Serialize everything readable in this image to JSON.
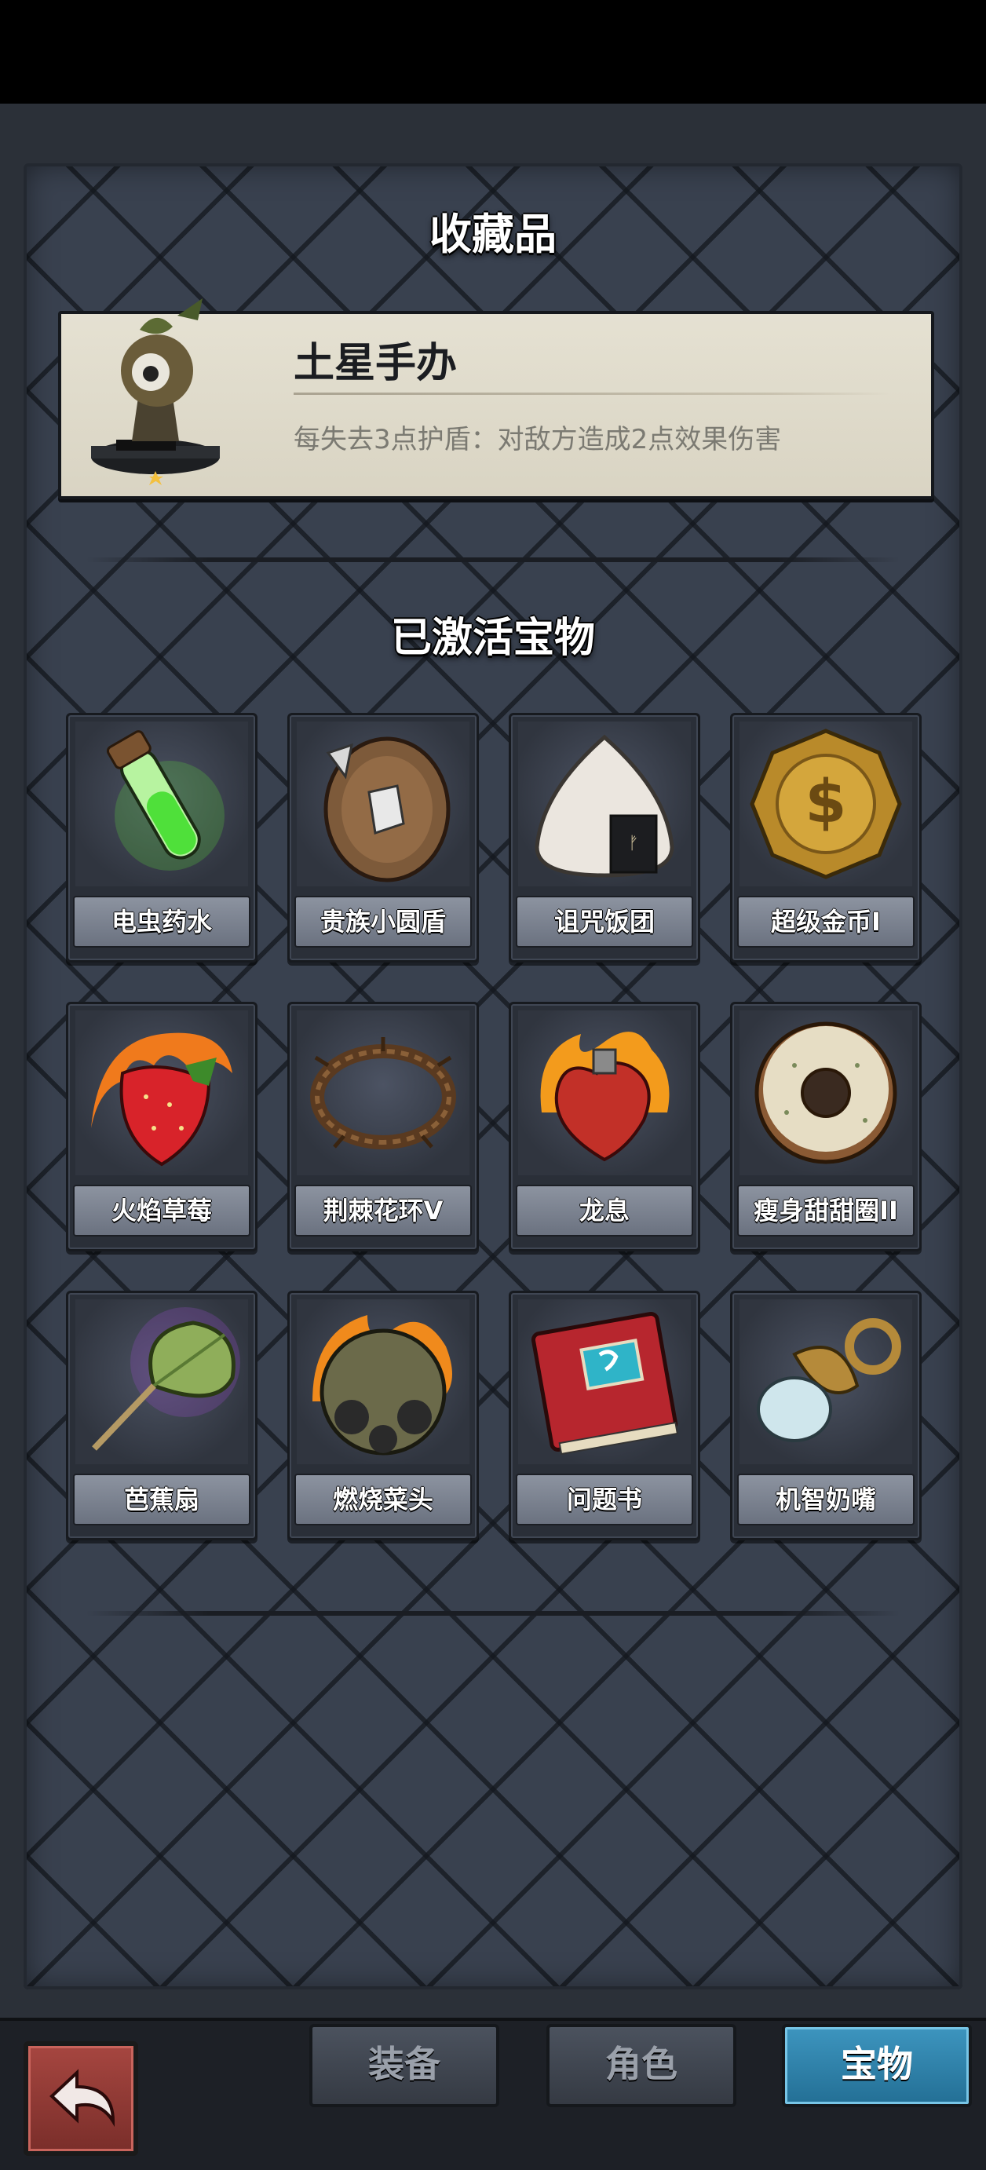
{
  "collection": {
    "title": "收藏品",
    "featured": {
      "name": "土星手办",
      "description": "每失去3点护盾：对敌方造成2点效果伤害",
      "icon": "saturn-figurine-icon"
    }
  },
  "treasures": {
    "title": "已激活宝物",
    "items": [
      {
        "label": "电虫药水",
        "icon": "potion-icon"
      },
      {
        "label": "贵族小圆盾",
        "icon": "round-shield-icon"
      },
      {
        "label": "诅咒饭团",
        "icon": "rice-ball-icon"
      },
      {
        "label": "超级金币I",
        "icon": "gold-coin-icon"
      },
      {
        "label": "火焰草莓",
        "icon": "strawberry-icon"
      },
      {
        "label": "荆棘花环V",
        "icon": "thorn-wreath-icon"
      },
      {
        "label": "龙息",
        "icon": "burning-heart-icon"
      },
      {
        "label": "瘦身甜甜圈II",
        "icon": "donut-icon"
      },
      {
        "label": "芭蕉扇",
        "icon": "leaf-fan-icon"
      },
      {
        "label": "燃烧菜头",
        "icon": "burning-bomb-icon"
      },
      {
        "label": "问题书",
        "icon": "book-icon"
      },
      {
        "label": "机智奶嘴",
        "icon": "pacifier-icon"
      }
    ]
  },
  "nav": {
    "back_icon": "back-arrow-icon",
    "tabs": [
      {
        "label": "装备",
        "active": false
      },
      {
        "label": "角色",
        "active": false
      },
      {
        "label": "宝物",
        "active": true
      }
    ]
  }
}
